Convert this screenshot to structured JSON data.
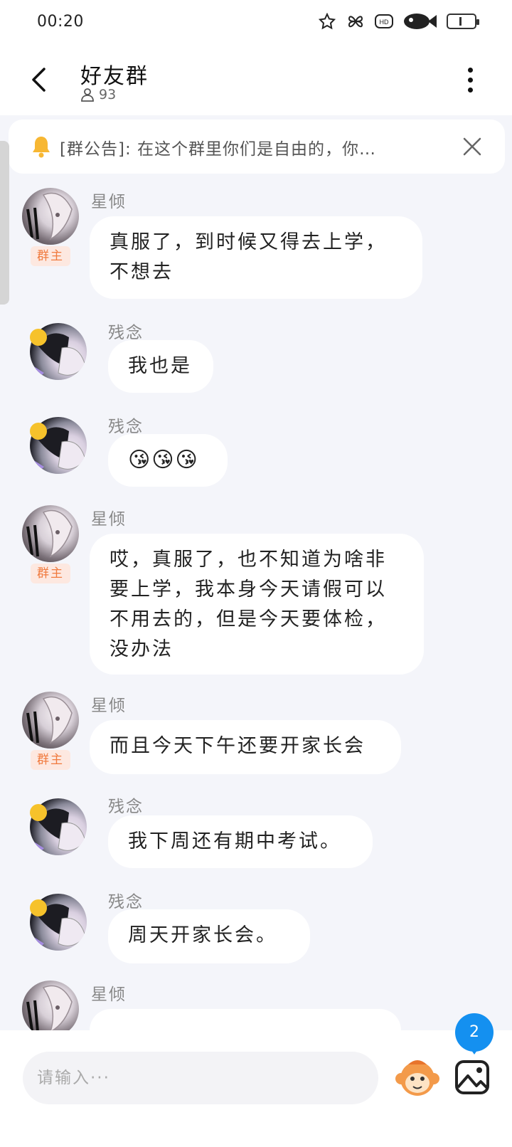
{
  "status_bar": {
    "time": "00:20",
    "icons": [
      "star-icon",
      "butterfly-icon",
      "hd-icon",
      "fish-icon",
      "battery-icon"
    ],
    "battery_text": "1"
  },
  "header": {
    "title": "好友群",
    "member_count": "93"
  },
  "announcement": {
    "text": "[群公告]: 在这个群里你们是自由的，你…"
  },
  "messages": [
    {
      "sender": "星倾",
      "role": "群主",
      "lines": [
        "真服了，到时候又得去上学，",
        "不想去"
      ]
    },
    {
      "sender": "残念",
      "role": "",
      "lines": [
        "我也是"
      ]
    },
    {
      "sender": "残念",
      "role": "",
      "lines": [
        "😘😘😘"
      ]
    },
    {
      "sender": "星倾",
      "role": "群主",
      "lines": [
        "哎，真服了，也不知道为啥非",
        "要上学，我本身今天请假可以",
        "不用去的，但是今天要体检，",
        "没办法"
      ]
    },
    {
      "sender": "星倾",
      "role": "群主",
      "lines": [
        "而且今天下午还要开家长会"
      ]
    },
    {
      "sender": "残念",
      "role": "",
      "lines": [
        "我下周还有期中考试。"
      ]
    },
    {
      "sender": "残念",
      "role": "",
      "lines": [
        "周天开家长会。"
      ]
    },
    {
      "sender": "星倾",
      "role": "",
      "lines": [
        "…"
      ]
    }
  ],
  "unread_count": "2",
  "input": {
    "placeholder": "请输入···"
  },
  "colors": {
    "accent": "#1490f0",
    "badge_bg": "#fde8e0",
    "badge_text": "#f07a3e",
    "background": "#f4f5fa"
  }
}
